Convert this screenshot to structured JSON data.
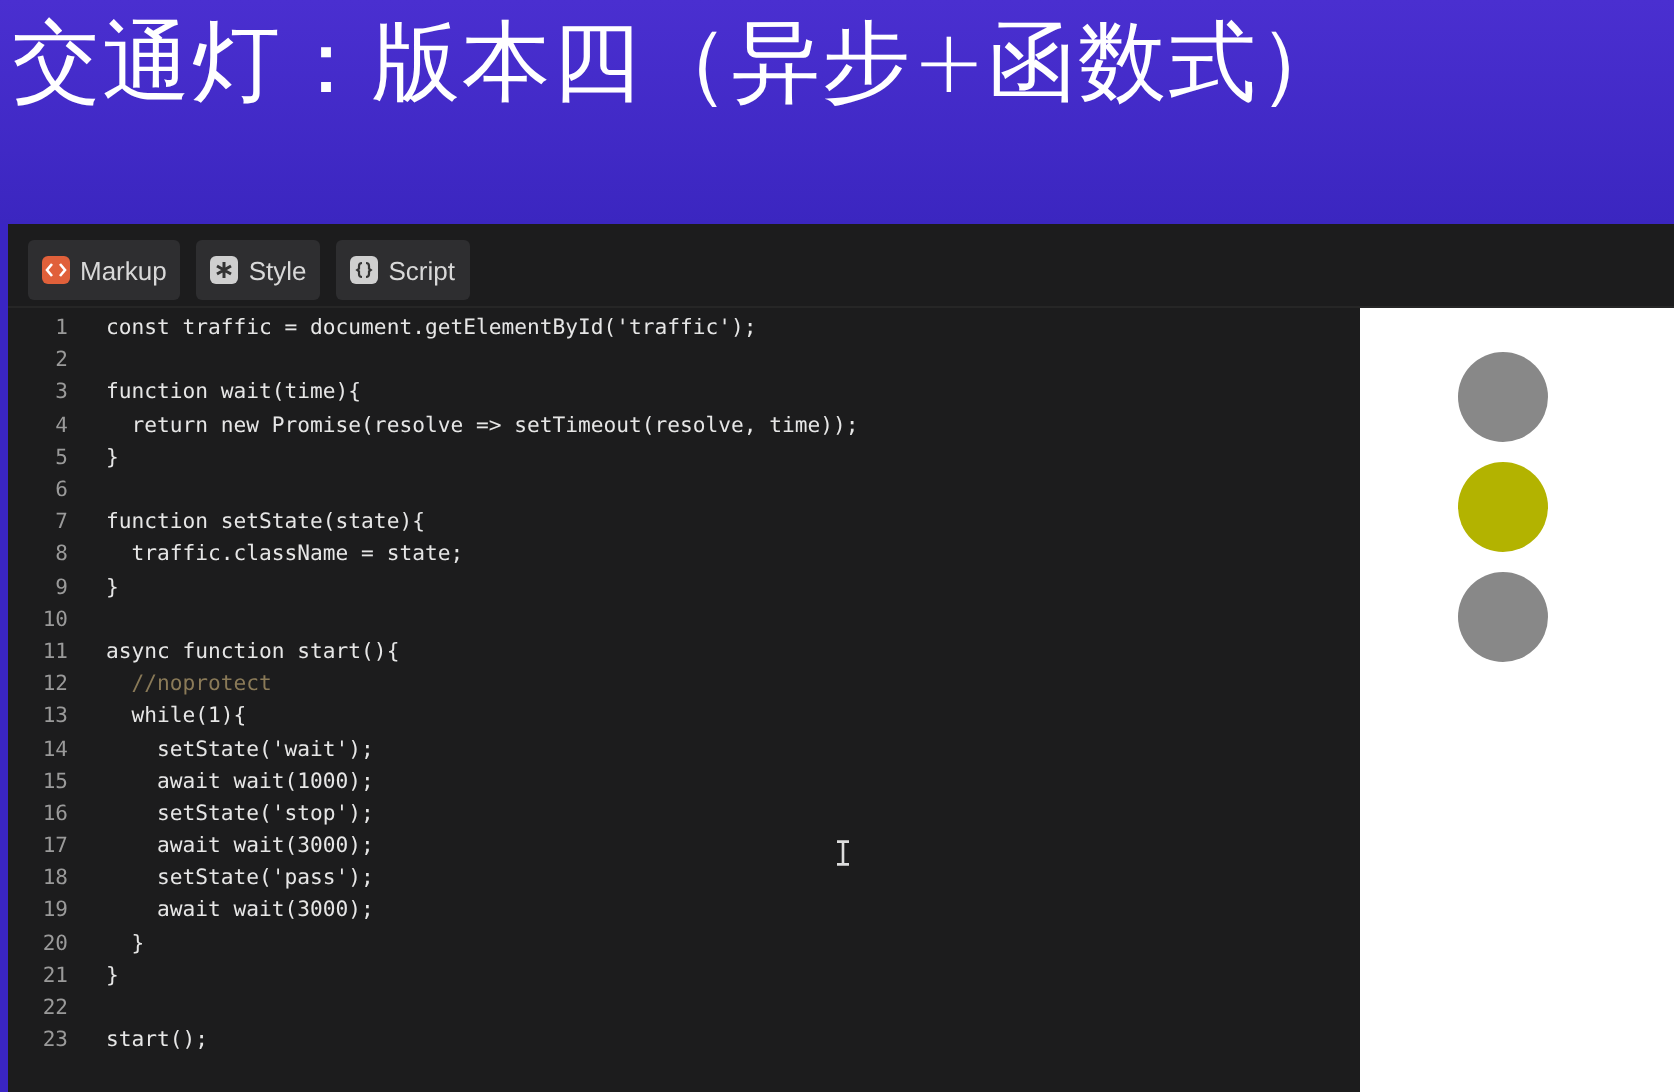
{
  "title": "交通灯：版本四（异步+函数式）",
  "tabs": [
    {
      "label": "Markup",
      "kind": "markup"
    },
    {
      "label": "Style",
      "kind": "style"
    },
    {
      "label": "Script",
      "kind": "script"
    }
  ],
  "code": [
    {
      "number": "1",
      "text": "const traffic = document.getElementById('traffic');"
    },
    {
      "number": "2"
    },
    {
      "number": "3",
      "text": "function wait(time){"
    },
    {
      "number": "4",
      "text": "  return new Promise(resolve => setTimeout(resolve, time));"
    },
    {
      "number": "5",
      "text": "}"
    },
    {
      "number": "6"
    },
    {
      "number": "7",
      "text": "function setState(state){"
    },
    {
      "number": "8",
      "text": "  traffic.className = state;"
    },
    {
      "number": "9",
      "text": "}"
    },
    {
      "number": "10"
    },
    {
      "number": "11",
      "text": "async function start(){"
    },
    {
      "number": "12",
      "text": "  //noprotect",
      "kind": "comment"
    },
    {
      "number": "13",
      "text": "  while(1){"
    },
    {
      "number": "14",
      "text": "    setState('wait');"
    },
    {
      "number": "15",
      "text": "    await wait(1000);"
    },
    {
      "number": "16",
      "text": "    setState('stop');"
    },
    {
      "number": "17",
      "text": "    await wait(3000);"
    },
    {
      "number": "18",
      "text": "    setState('pass');"
    },
    {
      "number": "19",
      "text": "    await wait(3000);"
    },
    {
      "number": "20",
      "text": "  }"
    },
    {
      "number": "21",
      "text": "}"
    },
    {
      "number": "22"
    },
    {
      "number": "23",
      "text": "start();"
    }
  ],
  "lights": [
    {
      "color": "#888888"
    },
    {
      "color": "#b3b300"
    },
    {
      "color": "#888888"
    }
  ]
}
